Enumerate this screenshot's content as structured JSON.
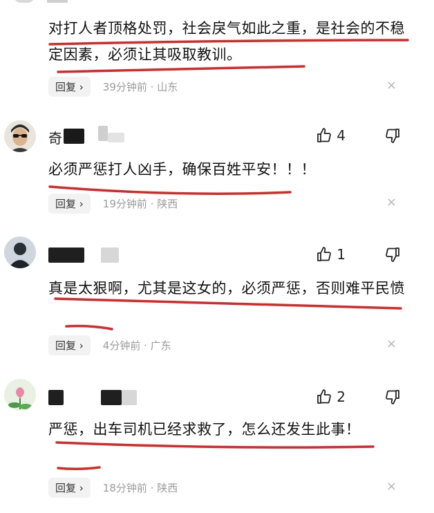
{
  "comments": [
    {
      "text": "对打人者顶格处罚，社会戾气如此之重，是社会的不稳定因素，必须让其吸取教训。",
      "reply_label": "回复",
      "meta": "39分钟前 · 山东",
      "close": "×"
    },
    {
      "name_prefix": "奇",
      "likes": "4",
      "text": "必须严惩打人凶手，确保百姓平安！！！",
      "reply_label": "回复",
      "meta": "19分钟前 · 陕西",
      "close": "×"
    },
    {
      "likes": "1",
      "text": "真是太狠啊，尤其是这女的，必须严惩，否则难平民愤",
      "reply_label": "回复",
      "meta": "4分钟前 · 广东",
      "close": "×"
    },
    {
      "likes": "2",
      "text": "严惩，出车司机已经求救了，怎么还发生此事！",
      "reply_label": "回复",
      "meta": "18分钟前 · 陕西",
      "close": "×"
    }
  ],
  "colors": {
    "underline": "#d42a2a",
    "meta": "#9a9a9a",
    "reply_bg": "#f2f2f2"
  },
  "icons": {
    "like": "thumbs-up-icon",
    "dislike": "thumbs-down-icon",
    "close": "close-icon"
  }
}
